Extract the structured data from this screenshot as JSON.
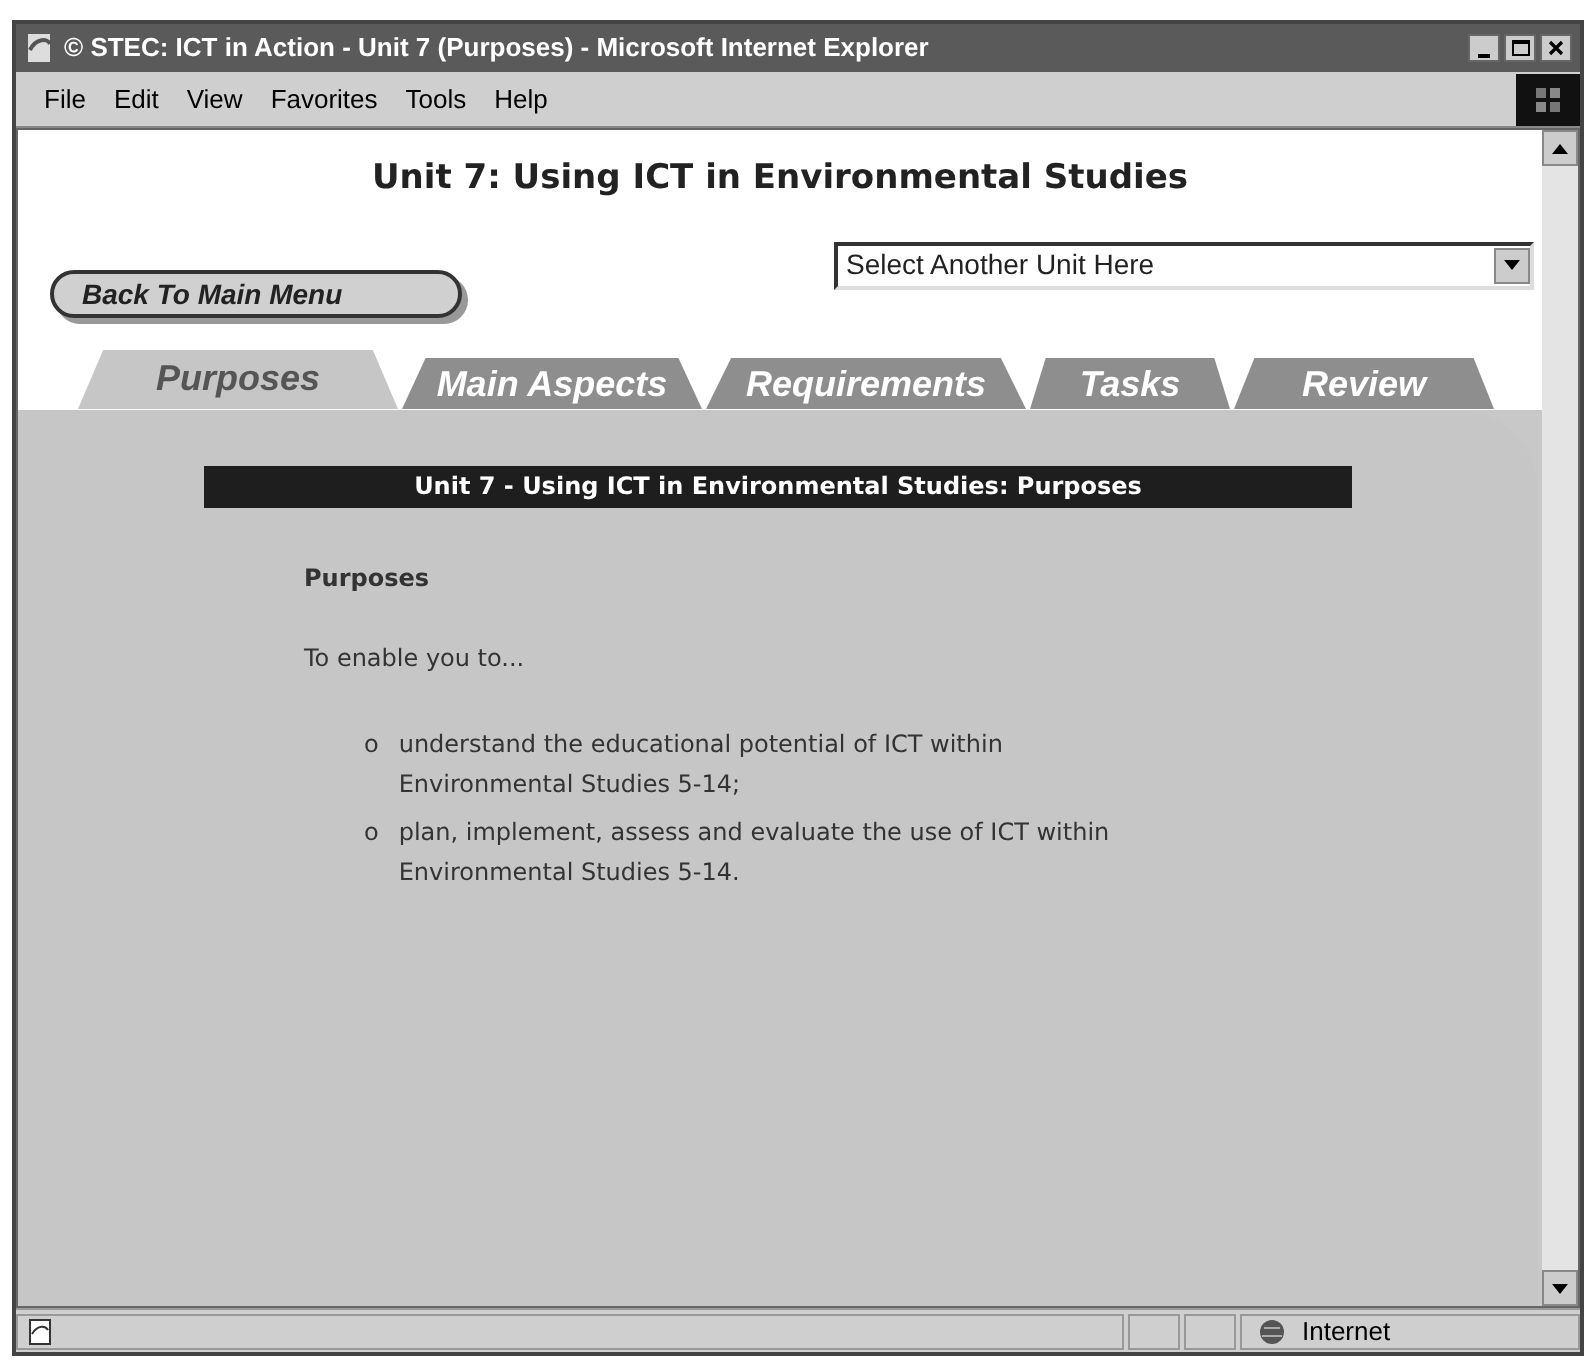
{
  "window": {
    "title": "© STEC: ICT in Action - Unit 7 (Purposes) - Microsoft Internet Explorer"
  },
  "menu": [
    "File",
    "Edit",
    "View",
    "Favorites",
    "Tools",
    "Help"
  ],
  "page": {
    "heading": "Unit 7: Using ICT in Environmental Studies",
    "back_button": "Back To Main Menu",
    "unit_select": {
      "value": "Select Another Unit Here"
    },
    "tabs": [
      {
        "label": "Purposes",
        "selected": true
      },
      {
        "label": "Main Aspects",
        "selected": false
      },
      {
        "label": "Requirements",
        "selected": false
      },
      {
        "label": "Tasks",
        "selected": false
      },
      {
        "label": "Review",
        "selected": false
      }
    ],
    "section_bar": "Unit 7 - Using ICT in Environmental Studies: Purposes",
    "subheading": "Purposes",
    "intro": "To enable you to...",
    "bullets": [
      {
        "marker": "o",
        "text": "understand the educational potential of ICT within Environmental Studies 5-14;"
      },
      {
        "marker": "o",
        "text": "plan, implement, assess and evaluate the use of ICT within Environmental Studies 5-14."
      }
    ]
  },
  "status_bar": {
    "zone": "Internet"
  }
}
